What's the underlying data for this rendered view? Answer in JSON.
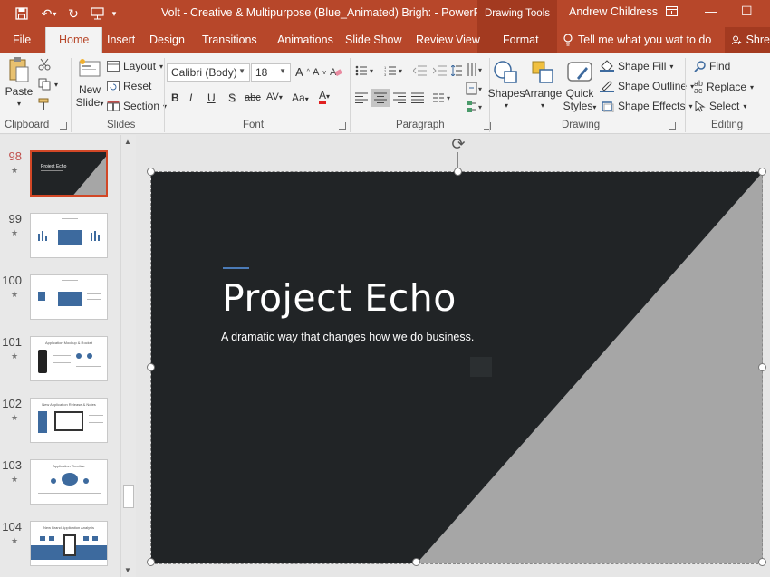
{
  "titlebar": {
    "document_title": "Volt - Creative & Multipurpose (Blue_Animated) Brigh: - PowerPoint",
    "contextual_group": "Drawing Tools",
    "user_name": "Andrew Childress",
    "window_buttons": [
      "—",
      "☐"
    ]
  },
  "quick_access": [
    {
      "icon": "save-icon"
    },
    {
      "icon": "undo-icon"
    },
    {
      "icon": "redo-icon"
    },
    {
      "icon": "start-presentation-icon"
    },
    {
      "icon": "customize-icon"
    }
  ],
  "tabs": [
    "File",
    "Home",
    "Insert",
    "Design",
    "Transitions",
    "Animations",
    "Slide Show",
    "Review",
    "View",
    "Format"
  ],
  "active_tab": "Home",
  "tell_me": "Tell me what you wat to do",
  "share_label": "Shre",
  "ribbon": {
    "clipboard": {
      "paste": "Paste",
      "group": "Clipboard"
    },
    "slides": {
      "new_slide_1": "New",
      "new_slide_2": "Slide",
      "layout": "Layout",
      "reset": "Reset",
      "section": "Section",
      "group": "Slides"
    },
    "font": {
      "font_name": "Calibri (Body)",
      "font_size": "18",
      "group": "Font",
      "buttons": [
        "B",
        "I",
        "U",
        "S",
        "abc",
        "AV",
        "Aa",
        "A"
      ]
    },
    "paragraph": {
      "group": "Paragraph"
    },
    "drawing": {
      "shapes": "Shapes",
      "arrange": "Arrange",
      "quick_1": "Quick",
      "quick_2": "Styles",
      "shape_fill": "Shape Fill",
      "shape_outline": "Shape Outline",
      "shape_effects": "Shape Effects",
      "group": "Drawing"
    },
    "editing": {
      "find": "Find",
      "replace": "Replace",
      "select": "Select",
      "group": "Editing"
    }
  },
  "thumbnails": [
    {
      "number": "98",
      "title": "Project Echo",
      "active": true
    },
    {
      "number": "99",
      "title": "",
      "active": false
    },
    {
      "number": "100",
      "title": "",
      "active": false
    },
    {
      "number": "101",
      "title": "Application Mockup & Rocket",
      "active": false
    },
    {
      "number": "102",
      "title": "New Application Release & Notes",
      "active": false
    },
    {
      "number": "103",
      "title": "Application Timeline",
      "active": false
    },
    {
      "number": "104",
      "title": "New Brand Application Analysis",
      "active": false
    }
  ],
  "slide": {
    "title": "Project Echo",
    "subtitle": "A dramatic way that changes how we do business.",
    "dark_color": "#212426",
    "gray_color": "#a6a6a6",
    "accent_color": "#4b7bb7"
  },
  "colors": {
    "ribbon_accent": "#b7472a",
    "contextual": "#a33a20",
    "selection": "#d24726"
  }
}
